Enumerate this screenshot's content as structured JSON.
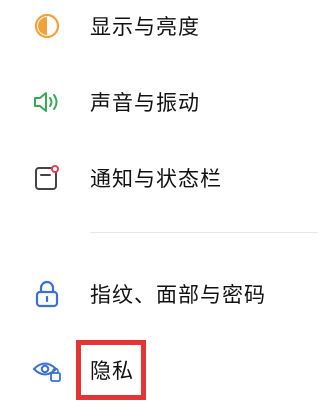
{
  "settings": {
    "items": [
      {
        "label": "显示与亮度",
        "icon": "display-brightness-icon"
      },
      {
        "label": "声音与振动",
        "icon": "sound-vibration-icon"
      },
      {
        "label": "通知与状态栏",
        "icon": "notification-statusbar-icon"
      },
      {
        "label": "指纹、面部与密码",
        "icon": "lock-icon"
      },
      {
        "label": "隐私",
        "icon": "privacy-eye-icon"
      }
    ]
  },
  "colors": {
    "display_icon": "#f0a33b",
    "sound_icon": "#3aa857",
    "notification_icon": "#444444",
    "notification_dot": "#e0405a",
    "lock_icon": "#3a6fd8",
    "privacy_icon": "#3a6fd8",
    "highlight_border": "#e33535"
  }
}
